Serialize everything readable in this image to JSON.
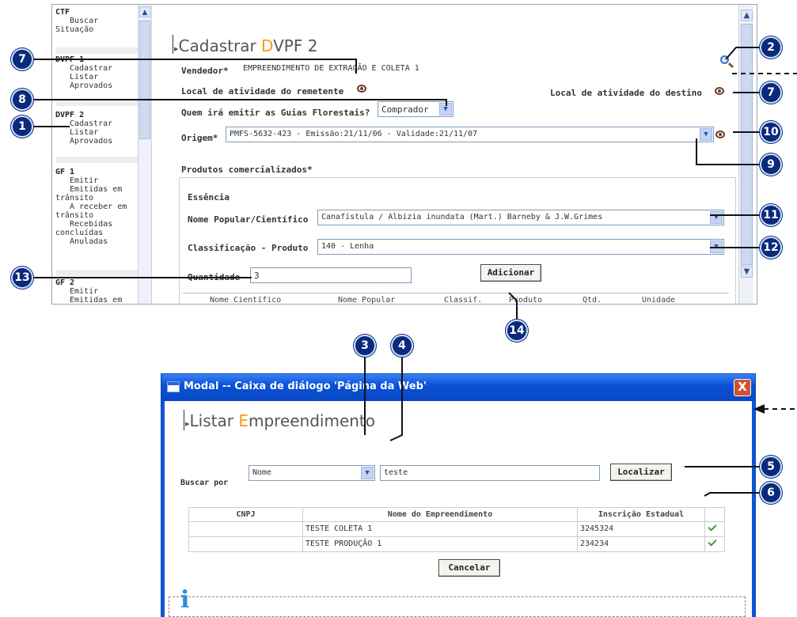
{
  "sidebar": {
    "groups": [
      {
        "title": "CTF",
        "items": [
          "Buscar Situação"
        ]
      },
      {
        "title": "DVPF 1",
        "items": [
          "Cadastrar",
          "Listar",
          "Aprovados"
        ]
      },
      {
        "title": "DVPF 2",
        "items": [
          "Cadastrar",
          "Listar",
          "Aprovados"
        ]
      },
      {
        "title": "GF 1",
        "items": [
          "Emitir",
          "Emitidas em trânsito",
          "A receber em trânsito",
          "Recebidas concluídas",
          "Anuladas"
        ]
      },
      {
        "title": "GF 2",
        "items": [
          "Emitir",
          "Emitidas em"
        ]
      }
    ]
  },
  "page": {
    "title_prefix": "Cadastrar ",
    "title_highlight": "D",
    "title_suffix": "VPF 2",
    "vendedor_label": "Vendedor*",
    "vendedor_value": "EMPREENDIMENTO DE EXTRAÇÃO E COLETA 1",
    "local_remetente_label": "Local de atividade do remetente",
    "local_destino_label": "Local de atividade do destino",
    "emitir_label": "Quem irá emitir as Guias Florestais?",
    "emitir_value": "Comprador",
    "origem_label": "Origem*",
    "origem_value": "PMFS-5632-423 - Emissão:21/11/06 - Validade:21/11/07",
    "produtos_label": "Produtos comercializados*",
    "essencia_label": "Essência",
    "nome_label": "Nome Popular/Científico",
    "nome_value": "Canafístula / Albizia inundata (Mart.) Barneby & J.W.Grimes",
    "classificacao_label": "Classificação - Produto",
    "classificacao_value": "140 - Lenha",
    "quantidade_label": "Quantidade",
    "quantidade_value": "3",
    "adicionar_label": "Adicionar",
    "table_partial_headers": [
      "Nome Científico",
      "Nome Popular",
      "Classif.",
      "Produto",
      "Qtd.",
      "Unidade"
    ]
  },
  "modal": {
    "window_title": "Modal -- Caixa de diálogo 'Página da Web'",
    "close_label": "X",
    "title_prefix": "Listar ",
    "title_highlight": "E",
    "title_suffix": "mpreendimento",
    "buscar_label": "Buscar por",
    "buscar_select": "Nome",
    "search_value": "teste",
    "localizar_label": "Localizar",
    "headers": [
      "CNPJ",
      "Nome do Empreendimento",
      "Inscrição Estadual"
    ],
    "rows": [
      {
        "cnpj": "",
        "nome": "TESTE COLETA 1",
        "inscricao": "3245324"
      },
      {
        "cnpj": "",
        "nome": "TESTE PRODUÇÃO 1",
        "inscricao": "234234"
      }
    ],
    "cancelar_label": "Cancelar",
    "info_icon": "i"
  },
  "callouts": [
    "1",
    "2",
    "3",
    "4",
    "5",
    "6",
    "7",
    "7",
    "8",
    "9",
    "10",
    "11",
    "12",
    "13",
    "14"
  ],
  "colors": {
    "accent_orange": "#f39c12",
    "callout_navy": "#0a2a7a",
    "xp_blue": "#0f56d9",
    "check_green": "#3aa12e"
  }
}
